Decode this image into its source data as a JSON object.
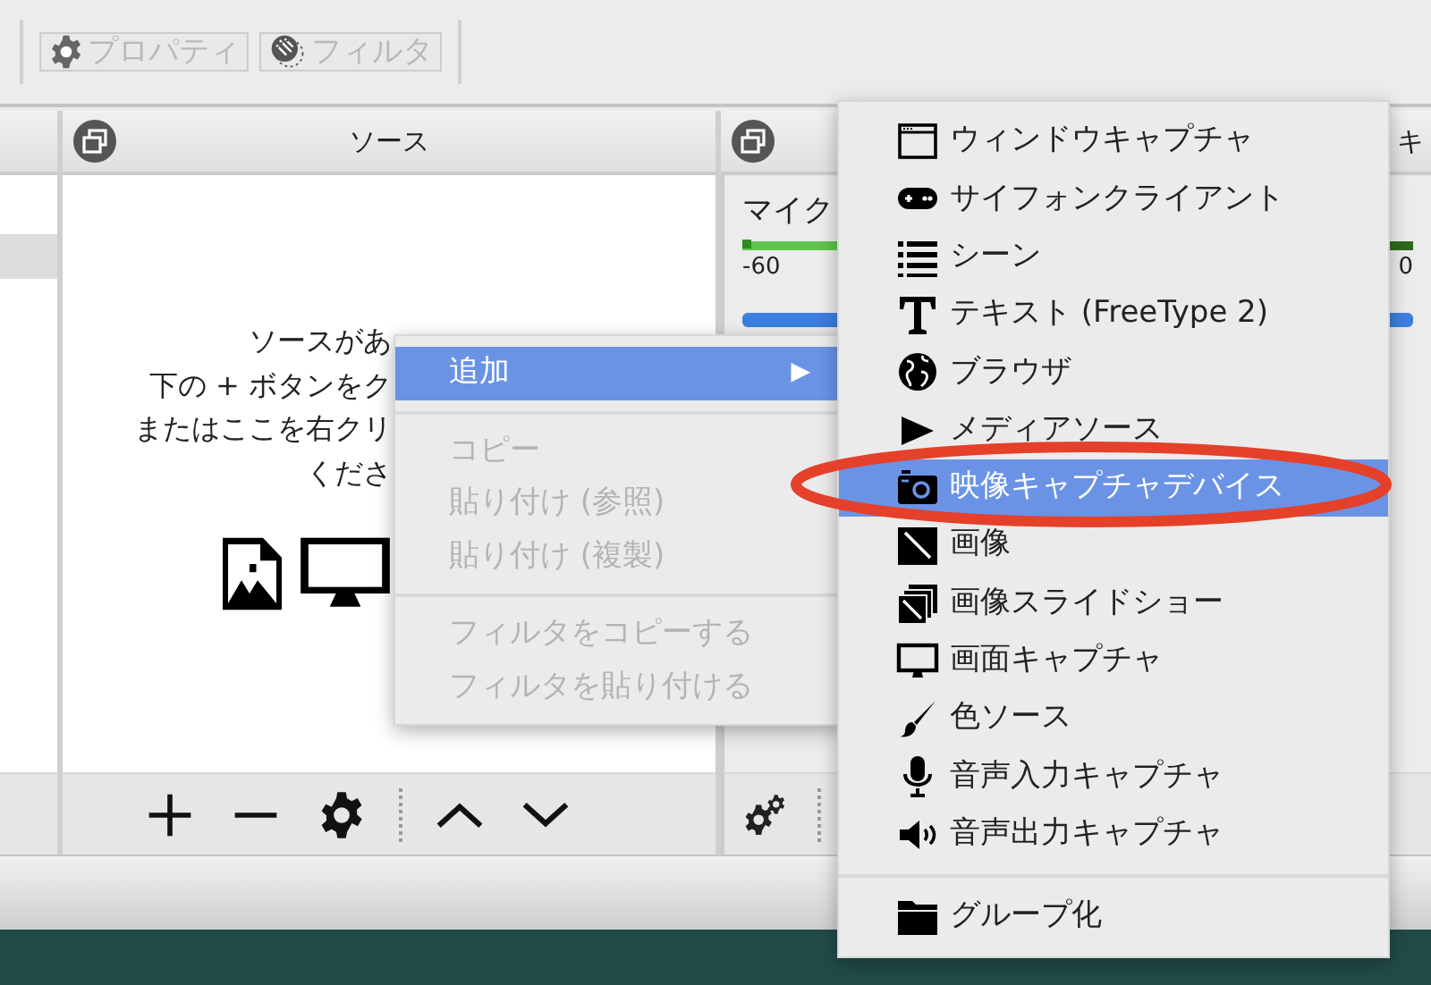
{
  "toolbar": {
    "buttons": [
      {
        "label": "プロパティ",
        "kind": "gear",
        "disabled": true
      },
      {
        "label": "フィルタ",
        "kind": "filter",
        "disabled": true
      }
    ]
  },
  "scenes": {
    "rows": [
      {
        "selected": true
      }
    ]
  },
  "sources": {
    "title": "ソース",
    "hint_lines": [
      "ソースがあ",
      "下の + ボタンをク",
      "またはここを右クリ",
      "くださ"
    ]
  },
  "mixer": {
    "channel": "マイク",
    "ticks": [
      "-60",
      "0"
    ],
    "volume": {
      "level": 1
    },
    "next_panel_title": "キ"
  },
  "context_menu": {
    "items": [
      {
        "label": "追加",
        "selected": true,
        "disabled": false,
        "arrow": "▶",
        "separator_before": false
      },
      {
        "label": "コピー",
        "selected": false,
        "disabled": true,
        "separator_before": true
      },
      {
        "label": "貼り付け (参照)",
        "selected": false,
        "disabled": true,
        "separator_before": false
      },
      {
        "label": "貼り付け (複製)",
        "selected": false,
        "disabled": true,
        "separator_before": false
      },
      {
        "label": "フィルタをコピーする",
        "selected": false,
        "disabled": true,
        "separator_before": true
      },
      {
        "label": "フィルタを貼り付ける",
        "selected": false,
        "disabled": true,
        "separator_before": false
      }
    ]
  },
  "add_submenu": {
    "items": [
      {
        "label": "ウィンドウキャプチャ",
        "kind": "window",
        "selected": false,
        "separator_before": false
      },
      {
        "label": "サイフォンクライアント",
        "kind": "gamepad",
        "selected": false,
        "separator_before": false
      },
      {
        "label": "シーン",
        "kind": "list",
        "selected": false,
        "separator_before": false
      },
      {
        "label": "テキスト (FreeType 2)",
        "kind": "text",
        "selected": false,
        "separator_before": false
      },
      {
        "label": "ブラウザ",
        "kind": "globe",
        "selected": false,
        "separator_before": false
      },
      {
        "label": "メディアソース",
        "kind": "play",
        "selected": false,
        "separator_before": false
      },
      {
        "label": "映像キャプチャデバイス",
        "kind": "camera",
        "selected": true,
        "separator_before": false
      },
      {
        "label": "画像",
        "kind": "image",
        "selected": false,
        "separator_before": false
      },
      {
        "label": "画像スライドショー",
        "kind": "slides",
        "selected": false,
        "separator_before": false
      },
      {
        "label": "画面キャプチャ",
        "kind": "monitor",
        "selected": false,
        "separator_before": false
      },
      {
        "label": "色ソース",
        "kind": "brush",
        "selected": false,
        "separator_before": false
      },
      {
        "label": "音声入力キャプチャ",
        "kind": "mic",
        "selected": false,
        "separator_before": false
      },
      {
        "label": "音声出力キャプチャ",
        "kind": "speaker",
        "selected": false,
        "separator_before": false
      },
      {
        "label": "グループ化",
        "kind": "folder",
        "selected": false,
        "separator_before": true
      }
    ]
  },
  "annotation": {
    "kind": "ellipse"
  }
}
